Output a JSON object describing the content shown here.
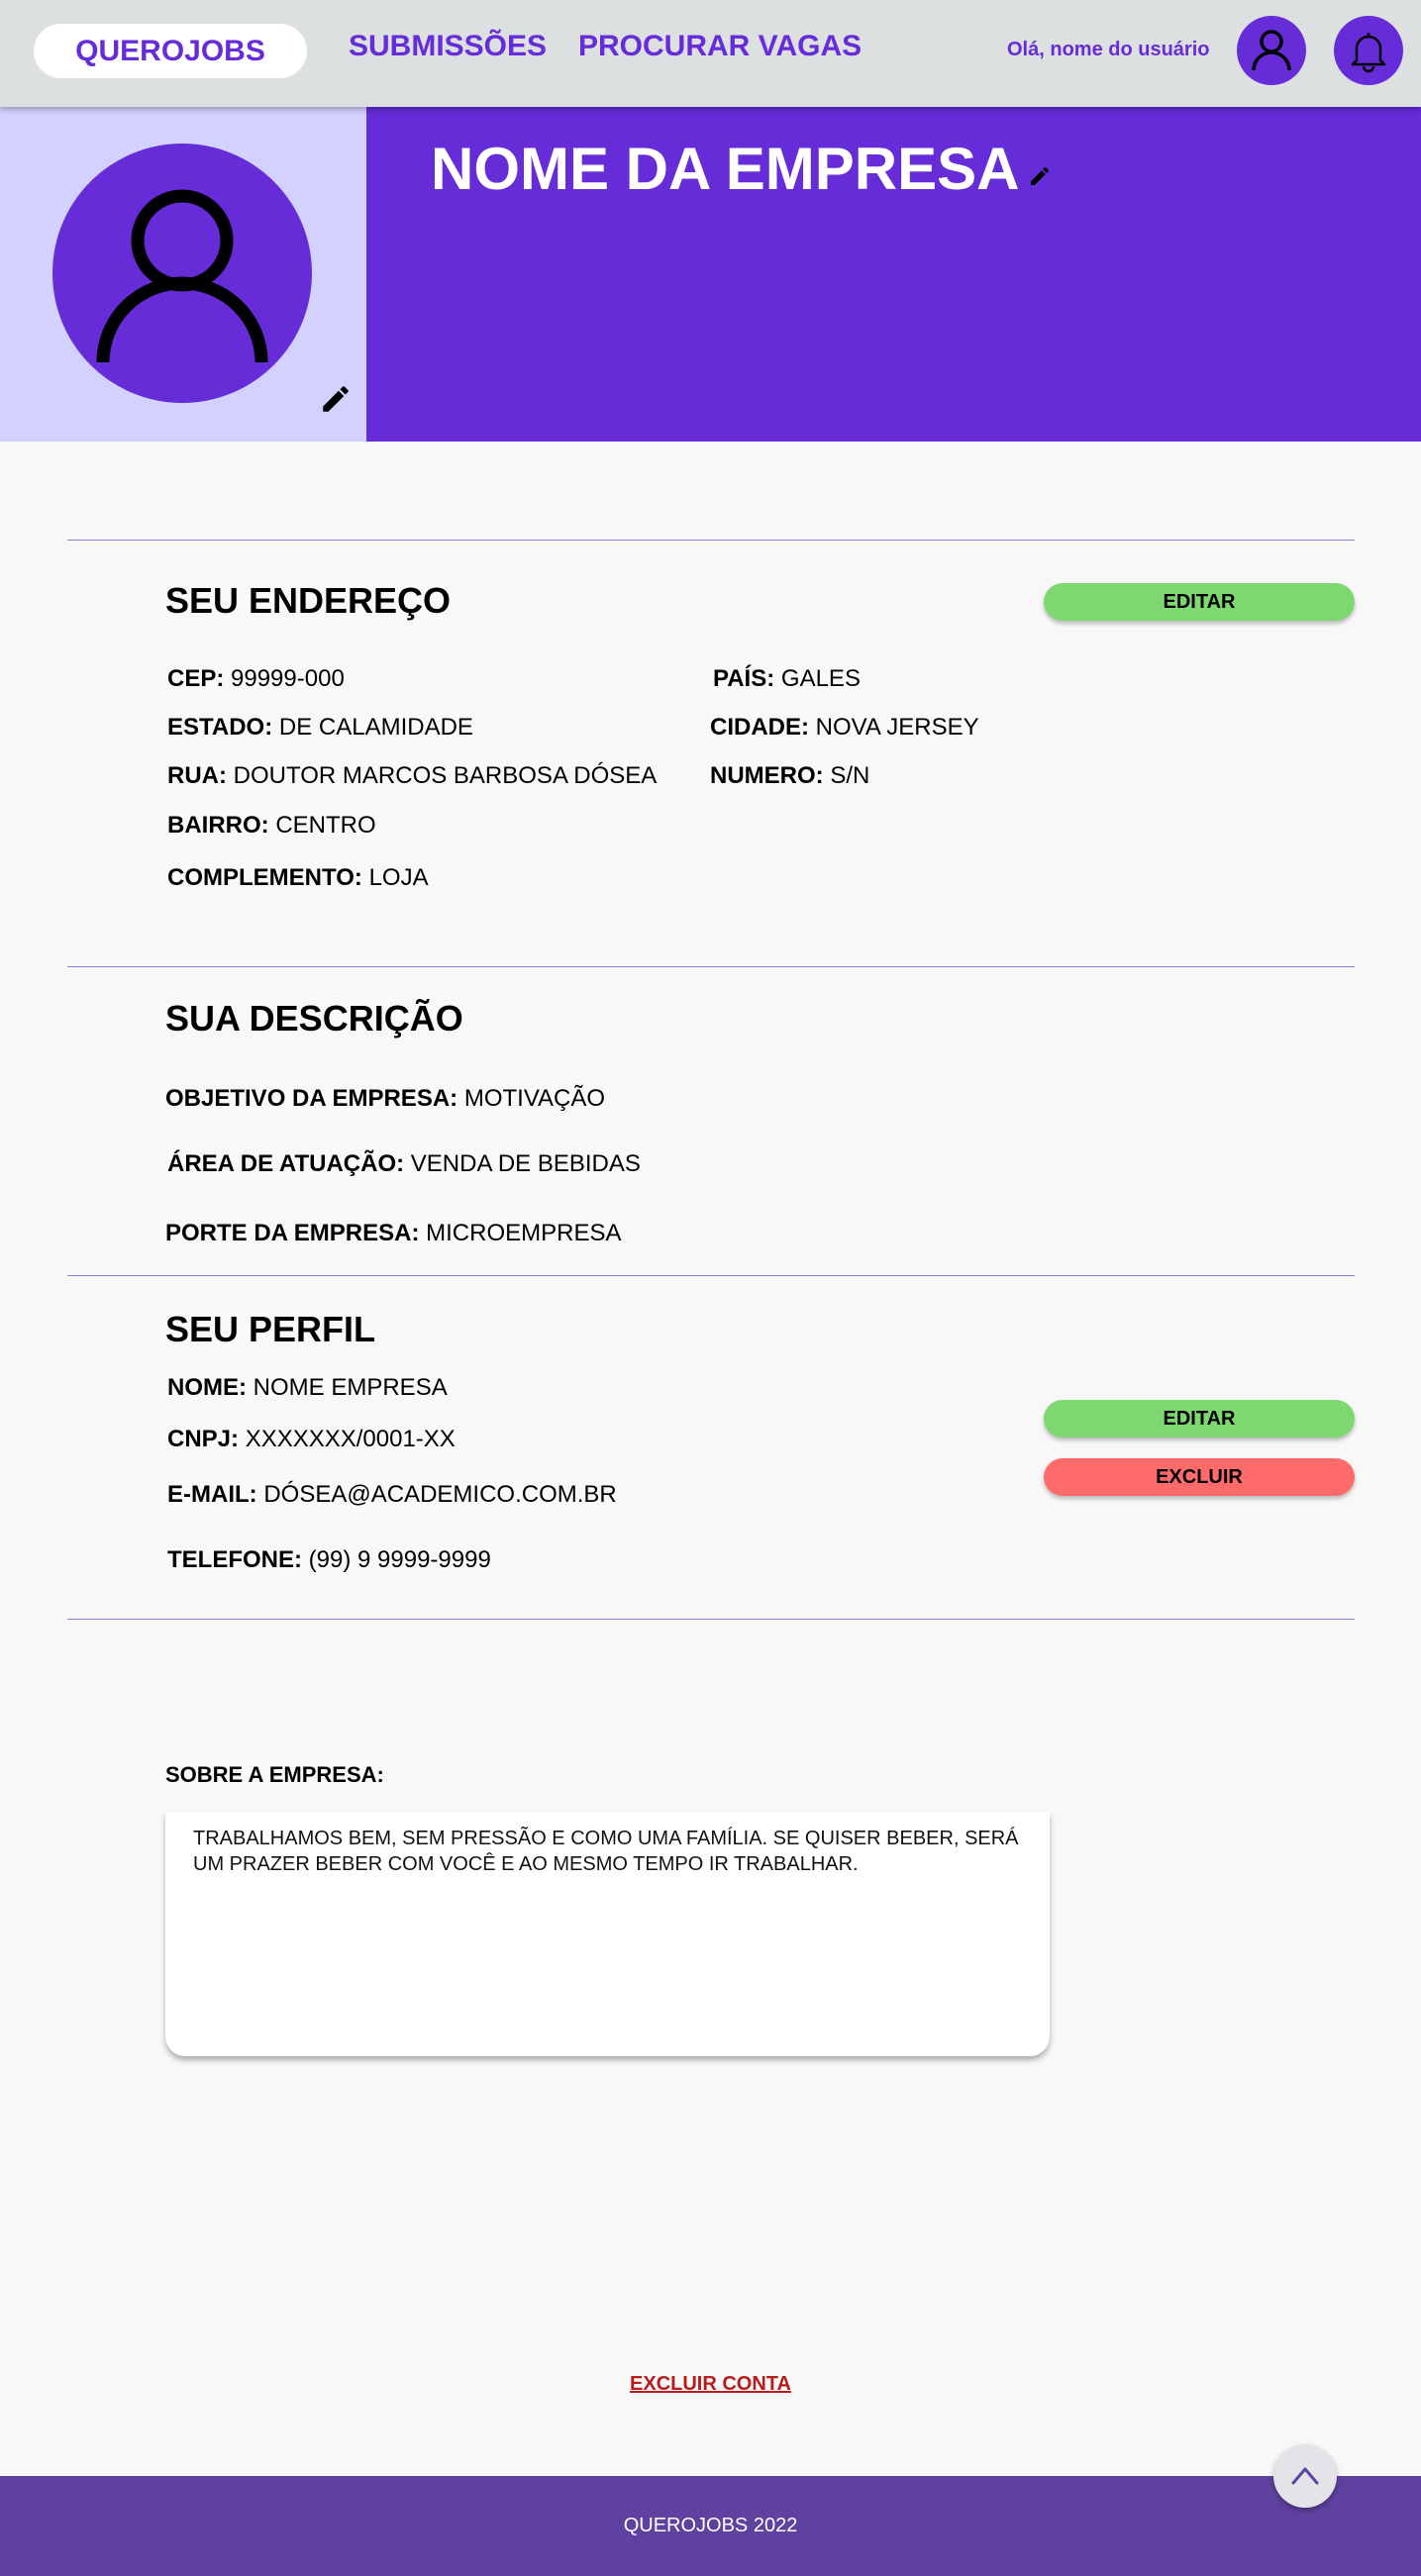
{
  "nav": {
    "brand": "QUEROJOBS",
    "links": [
      "SUBMISSÕES",
      "PROCURAR VAGAS"
    ],
    "greeting": "Olá, nome do usuário"
  },
  "header": {
    "company_name": "NOME DA EMPRESA"
  },
  "address": {
    "title": "SEU ENDEREÇO",
    "edit_label": "EDITAR",
    "fields": [
      {
        "label": "CEP:",
        "value": "99999-000"
      },
      {
        "label": "PAÍS:",
        "value": "GALES"
      },
      {
        "label": "ESTADO:",
        "value": "DE CALAMIDADE"
      },
      {
        "label": "CIDADE:",
        "value": "NOVA JERSEY"
      },
      {
        "label": "RUA:",
        "value": "DOUTOR MARCOS BARBOSA DÓSEA"
      },
      {
        "label": "NUMERO:",
        "value": "S/N"
      },
      {
        "label": "BAIRRO:",
        "value": "CENTRO"
      },
      {
        "label": "COMPLEMENTO:",
        "value": "LOJA"
      }
    ]
  },
  "description": {
    "title": "SUA DESCRIÇÃO",
    "fields": [
      {
        "label": "OBJETIVO DA EMPRESA:",
        "value": "MOTIVAÇÃO"
      },
      {
        "label": "ÁREA DE ATUAÇÃO:",
        "value": "VENDA DE BEBIDAS"
      },
      {
        "label": "PORTE DA EMPRESA:",
        "value": "MICROEMPRESA"
      }
    ]
  },
  "profile": {
    "title": "SEU PERFIL",
    "edit_label": "EDITAR",
    "delete_label": "EXCLUIR",
    "fields": [
      {
        "label": "NOME:",
        "value": "NOME EMPRESA"
      },
      {
        "label": "CNPJ:",
        "value": "XXXXXXX/0001-XX"
      },
      {
        "label": "E-MAIL:",
        "value": "DÓSEA@ACADEMICO.COM.BR"
      },
      {
        "label": "TELEFONE:",
        "value": "(99) 9 9999-9999"
      }
    ]
  },
  "about": {
    "label": "SOBRE A EMPRESA:",
    "text": "TRABALHAMOS BEM, SEM PRESSÃO E COMO UMA FAMÍLIA. SE QUISER BEBER, SERÁ UM PRAZER BEBER COM VOCÊ E AO MESMO TEMPO IR TRABALHAR."
  },
  "delete_account_label": "EXCLUIR CONTA",
  "footer": {
    "text": "QUEROJOBS 2022"
  },
  "colors": {
    "accent": "#652cd8",
    "banner_light": "#d2d1ff",
    "green": "#7dd870",
    "red": "#ff6b6b",
    "footer": "#5f42a0"
  },
  "icons": [
    "user-icon",
    "bell-icon",
    "pencil-icon",
    "chevron-up-icon"
  ]
}
